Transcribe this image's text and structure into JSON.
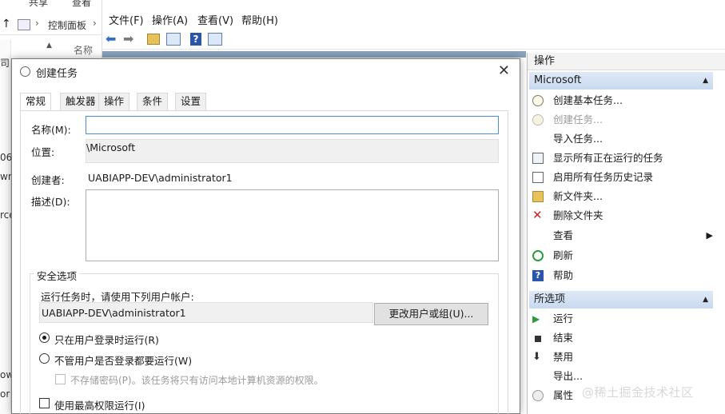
{
  "control_panel": {
    "top_labels": [
      "共享",
      "查看"
    ],
    "breadcrumb": "控制面板",
    "column_header": "名称",
    "clip_texts": [
      "司",
      "06",
      "wn",
      "rce",
      "ow",
      "or"
    ]
  },
  "mmc": {
    "menu": [
      "文件(F)",
      "操作(A)",
      "查看(V)",
      "帮助(H)"
    ]
  },
  "actions_pane": {
    "header": "操作",
    "section1": "Microsoft",
    "items1": [
      {
        "label": "创建基本任务...",
        "icon": "create-basic-task-icon",
        "disabled": false
      },
      {
        "label": "创建任务...",
        "icon": "create-task-icon",
        "disabled": true
      },
      {
        "label": "导入任务...",
        "icon": "",
        "disabled": false
      },
      {
        "label": "显示所有正在运行的任务",
        "icon": "running-tasks-icon",
        "disabled": false
      },
      {
        "label": "启用所有任务历史记录",
        "icon": "history-icon",
        "disabled": false
      },
      {
        "label": "新文件夹...",
        "icon": "folder-icon",
        "disabled": false
      },
      {
        "label": "删除文件夹",
        "icon": "delete-icon",
        "disabled": false
      },
      {
        "label": "查看",
        "icon": "",
        "disabled": false,
        "submenu": true
      },
      {
        "label": "刷新",
        "icon": "refresh-icon",
        "disabled": false
      },
      {
        "label": "帮助",
        "icon": "help-icon",
        "disabled": false
      }
    ],
    "section2": "所选项",
    "items2": [
      {
        "label": "运行",
        "icon": "run-icon"
      },
      {
        "label": "结束",
        "icon": "stop-icon"
      },
      {
        "label": "禁用",
        "icon": "disable-icon"
      },
      {
        "label": "导出...",
        "icon": ""
      },
      {
        "label": "属性",
        "icon": "properties-icon"
      }
    ]
  },
  "dialog": {
    "title": "创建任务",
    "tabs": [
      "常规",
      "触发器",
      "操作",
      "条件",
      "设置"
    ],
    "active_tab": "常规",
    "name_label": "名称(M):",
    "name_value": "",
    "location_label": "位置:",
    "location_value": "\\Microsoft",
    "author_label": "创建者:",
    "author_value": "UABIAPP-DEV\\administrator1",
    "description_label": "描述(D):",
    "description_value": "",
    "security_group_title": "安全选项",
    "run_as_prompt": "运行任务时，请使用下列用户帐户:",
    "run_as_user": "UABIAPP-DEV\\administrator1",
    "change_user_button": "更改用户或组(U)...",
    "radio_logged_on": "只在用户登录时运行(R)",
    "radio_whether_logged_on": "不管用户是否登录都要运行(W)",
    "radio_selected": "logged_on",
    "no_store_password": "不存储密码(P)。该任务将只有访问本地计算机资源的权限。",
    "highest_privileges": "使用最高权限运行(I)"
  },
  "watermark": "@稀土掘金技术社区",
  "colors": {
    "accent_blue": "#4a8fd4",
    "section_header": "#c9d9ee",
    "run_green": "#2e9b3a",
    "delete_red": "#d42020"
  }
}
